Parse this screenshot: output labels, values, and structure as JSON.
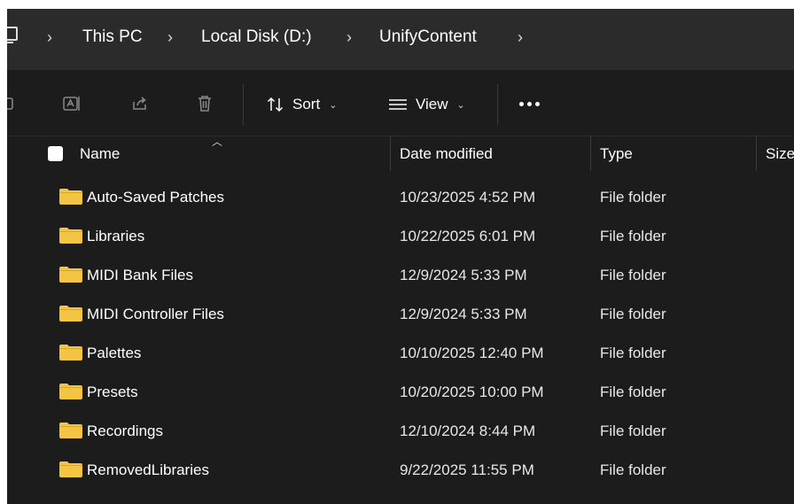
{
  "breadcrumb": {
    "items": [
      "This PC",
      "Local Disk (D:)",
      "UnifyContent"
    ],
    "separator": "›"
  },
  "toolbar": {
    "sort_label": "Sort",
    "view_label": "View"
  },
  "columns": {
    "name": "Name",
    "date_modified": "Date modified",
    "type": "Type",
    "size": "Size"
  },
  "files": [
    {
      "name": "Auto-Saved Patches",
      "date": "10/23/2025 4:52 PM",
      "type": "File folder"
    },
    {
      "name": "Libraries",
      "date": "10/22/2025 6:01 PM",
      "type": "File folder"
    },
    {
      "name": "MIDI Bank Files",
      "date": "12/9/2024 5:33 PM",
      "type": "File folder"
    },
    {
      "name": "MIDI Controller Files",
      "date": "12/9/2024 5:33 PM",
      "type": "File folder"
    },
    {
      "name": "Palettes",
      "date": "10/10/2025 12:40 PM",
      "type": "File folder"
    },
    {
      "name": "Presets",
      "date": "10/20/2025 10:00 PM",
      "type": "File folder"
    },
    {
      "name": "Recordings",
      "date": "12/10/2024 8:44 PM",
      "type": "File folder"
    },
    {
      "name": "RemovedLibraries",
      "date": "9/22/2025 11:55 PM",
      "type": "File folder"
    }
  ],
  "colors": {
    "background": "#1c1c1c",
    "address_bar": "#2b2b2b",
    "folder": "#f4c542",
    "text": "#ffffff"
  },
  "icons": {
    "address": "computer-icon",
    "toolbar": [
      "new-folder-icon",
      "rename-icon",
      "share-icon",
      "delete-icon",
      "sort-icon",
      "view-icon",
      "more-icon"
    ],
    "row": "folder-icon"
  }
}
